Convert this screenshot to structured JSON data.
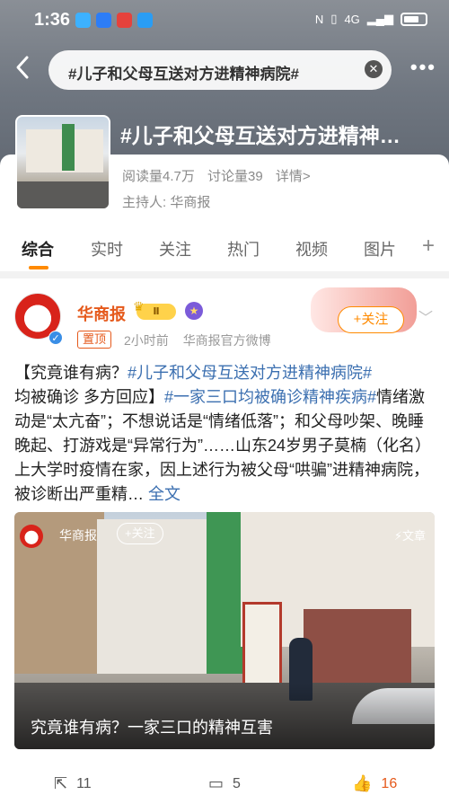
{
  "status": {
    "time": "1:36",
    "network": "4G",
    "app_icons": [
      {
        "icon": "bubble-app-icon",
        "color": "#3db1ff"
      },
      {
        "icon": "cloud-app-icon",
        "color": "#2d7df6"
      },
      {
        "icon": "checkmark-app-icon",
        "color": "#e5423c"
      },
      {
        "icon": "globe-app-icon",
        "color": "#2a9df4"
      }
    ]
  },
  "header": {
    "search_text": "#儿子和父母互送对方进精神病院#",
    "clear_icon": "close-icon",
    "more_icon": "more-icon",
    "back_icon": "back-arrow-icon"
  },
  "topic": {
    "title": "#儿子和父母互送对方进精神…",
    "reads": "阅读量4.7万",
    "discussions": "讨论量39",
    "details": "详情>",
    "host_label": "主持人:",
    "host_name": "华商报"
  },
  "tabs": [
    "综合",
    "实时",
    "关注",
    "热门",
    "视频",
    "图片"
  ],
  "active_tab": "综合",
  "post": {
    "author": "华商报",
    "level": "Ⅱ",
    "pinned": "置顶",
    "time": "2小时前",
    "source": "华商报官方微博",
    "follow_label": "+关注",
    "body": {
      "p1": "【究竟谁有病？",
      "tag1": "#儿子和父母互送对方进精神病院#",
      "p2": "均被确诊 多方回应】",
      "tag2": "#一家三口均被确诊精神疾病#",
      "p3": "情绪激动是“太亢奋”；不想说话是“情绪低落”；和父母吵架、晚睡晚起、打游戏是“异常行为”……山东24岁男子莫楠（化名）上大学时疫情在家，因上述行为被父母“哄骗”进精神病院，被诊断出严重精…",
      "full_text": "全文"
    },
    "media": {
      "author": "华商报",
      "follow_label": "+关注",
      "type_label": "文章",
      "caption": "究竟谁有病？一家三口的精神互害"
    },
    "actions": {
      "shares": "11",
      "comments": "5",
      "likes": "16"
    }
  },
  "colors": {
    "accent": "#ff8a00",
    "link": "#3b6fb0",
    "brand": "#e5591b"
  }
}
